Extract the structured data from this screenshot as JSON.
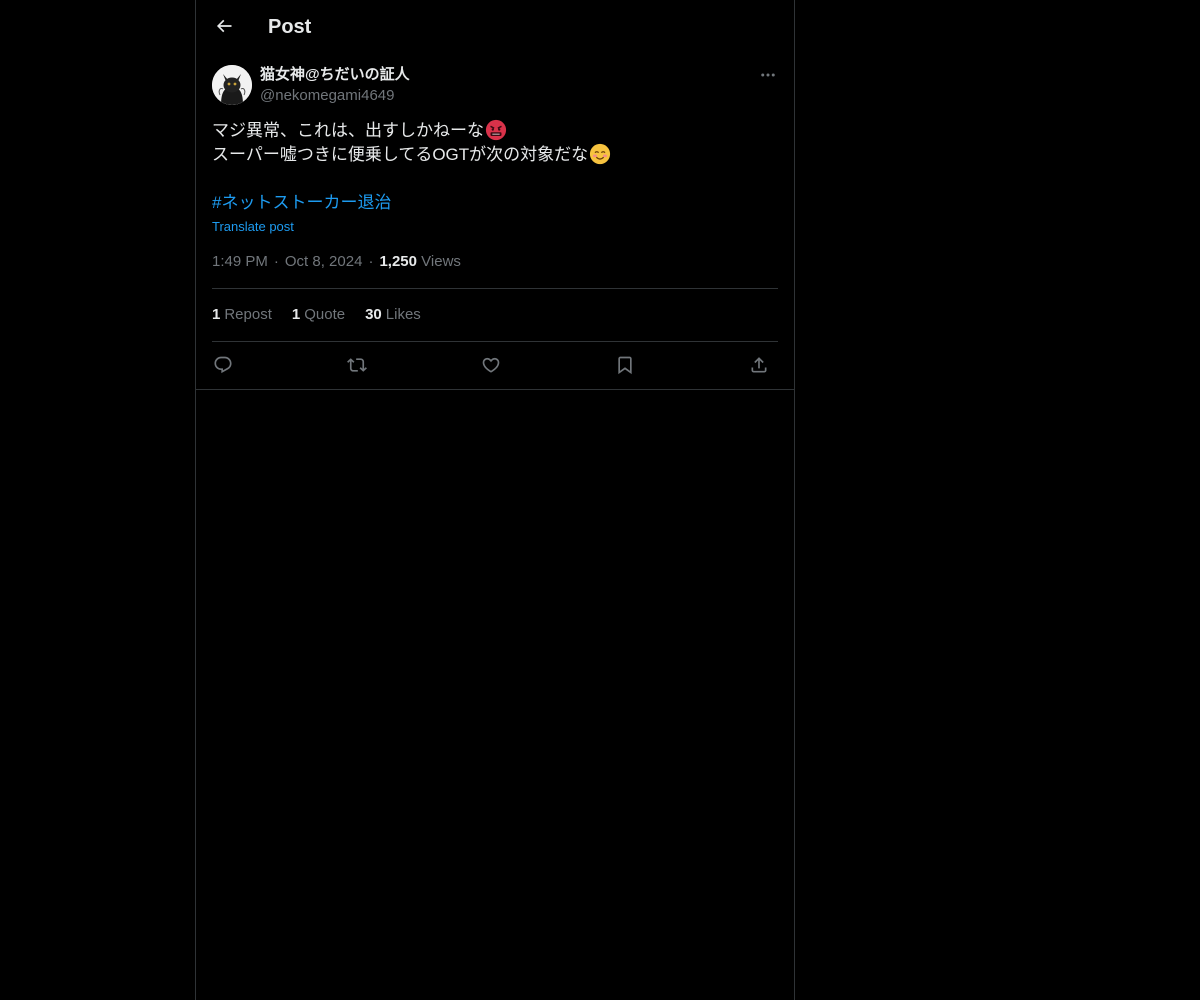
{
  "header": {
    "title": "Post",
    "back_icon": "arrow-left-icon"
  },
  "author": {
    "display_name": "猫女神@ちだいの証人",
    "handle": "@nekomegami4649",
    "avatar_icon": "cat-avatar"
  },
  "post": {
    "line1": "マジ異常、これは、出すしかねーな",
    "line1_emoji": "angry-face-emoji",
    "line2": "スーパー嘘つきに便乗してるOGTが次の対象だな",
    "line2_emoji": "smiling-face-emoji",
    "hashtag": "#ネットストーカー退治",
    "translate_label": "Translate post"
  },
  "meta": {
    "time": "1:49 PM",
    "date": "Oct 8, 2024",
    "views_count": "1,250",
    "views_label": "Views"
  },
  "stats": {
    "reposts_count": "1",
    "reposts_label": "Repost",
    "quotes_count": "1",
    "quotes_label": "Quote",
    "likes_count": "30",
    "likes_label": "Likes"
  },
  "actions": [
    "reply-icon",
    "repost-icon",
    "like-icon",
    "bookmark-icon",
    "share-icon"
  ],
  "colors": {
    "background": "#000000",
    "text": "#e7e9ea",
    "secondary": "#71767b",
    "accent": "#1d9bf0",
    "border": "#2f3336"
  }
}
